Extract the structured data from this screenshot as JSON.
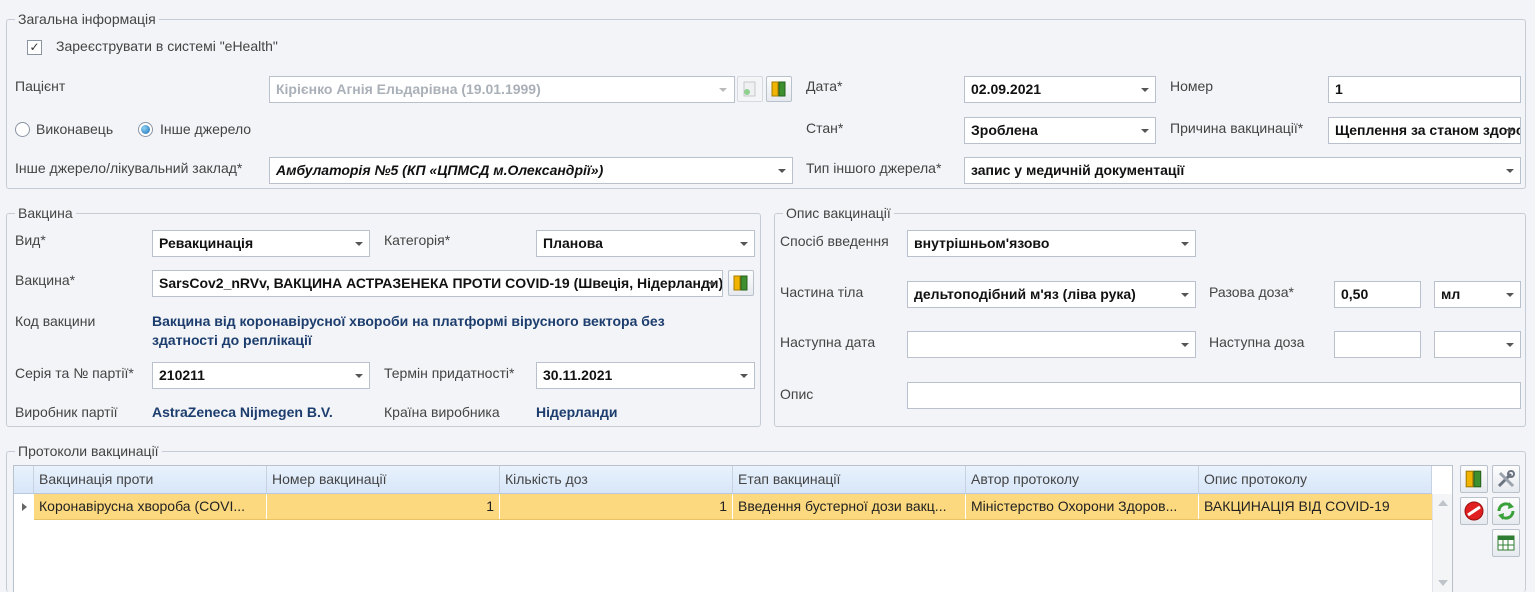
{
  "general": {
    "title": "Загальна інформація",
    "register_label": "Зареєструвати в системі \"eHealth\"",
    "register_checked": true,
    "patient_label": "Пацієнт",
    "patient_value": "Кірієнко Агнія Ельдарівна (19.01.1999)",
    "date_label": "Дата*",
    "date_value": "02.09.2021",
    "number_label": "Номер",
    "number_value": "1",
    "performer_label": "Виконавець",
    "other_source_label": "Інше джерело",
    "selected_radio": "other_source",
    "state_label": "Стан*",
    "state_value": "Зроблена",
    "reason_label": "Причина вакцинації*",
    "reason_value": "Щеплення за станом здоров'я",
    "facility_label": "Інше джерело/лікувальний заклад*",
    "facility_value": "Амбулаторія №5 (КП «ЦПМСД м.Олександрії»)",
    "other_source_type_label": "Тип іншого джерела*",
    "other_source_type_value": "запис у медичній документації"
  },
  "vaccine": {
    "title": "Вакцина",
    "type_label": "Вид*",
    "type_value": "Ревакцинація",
    "category_label": "Категорія*",
    "category_value": "Планова",
    "vaccine_label": "Вакцина*",
    "vaccine_value": "SarsCov2_nRVv, ВАКЦИНА АСТРАЗЕНЕКА ПРОТИ COVID-19 (Швеція, Нідерланди)",
    "code_label": "Код вакцини",
    "code_value_line1": "Вакцина від коронавірусної хвороби на платформі вірусного вектора без",
    "code_value_line2": "здатності до реплікації",
    "series_label": "Серія та № партії*",
    "series_value": "210211",
    "expiry_label": "Термін придатності*",
    "expiry_value": "30.11.2021",
    "manufacturer_label": "Виробник партії",
    "manufacturer_value": "AstraZeneca Nijmegen B.V.",
    "country_label": "Країна виробника",
    "country_value": "Нідерланди"
  },
  "description": {
    "title": "Опис вакцинації",
    "route_label": "Спосіб введення",
    "route_value": "внутрішньом'язово",
    "body_part_label": "Частина тіла",
    "body_part_value": "дельтоподібний м'яз (ліва рука)",
    "single_dose_label": "Разова доза*",
    "single_dose_value": "0,50",
    "unit_value": "мл",
    "next_date_label": "Наступна дата",
    "next_date_value": "",
    "next_dose_label": "Наступна доза",
    "next_dose_value": "",
    "next_dose_unit_value": "",
    "notes_label": "Опис",
    "notes_value": ""
  },
  "protocols": {
    "title": "Протоколи вакцинації",
    "columns": [
      "Вакцинація проти",
      "Номер вакцинації",
      "Кількість доз",
      "Етап вакцинації",
      "Автор протоколу",
      "Опис протоколу"
    ],
    "rows": [
      [
        "Коронавірусна хвороба (COVI...",
        "1",
        "1",
        "Введення бустерної дози вакц...",
        "Міністерство Охорони Здоров...",
        "ВАКЦИНАЦІЯ ВІД COVID-19"
      ]
    ]
  },
  "colors": {
    "selected_row": "#fcd97f",
    "value_text": "#1c3d6e",
    "accent_radio": "#1769b3"
  },
  "icons": [
    "book-icon",
    "tools-icon",
    "delete-icon",
    "refresh-icon",
    "excel-icon",
    "document-icon"
  ]
}
